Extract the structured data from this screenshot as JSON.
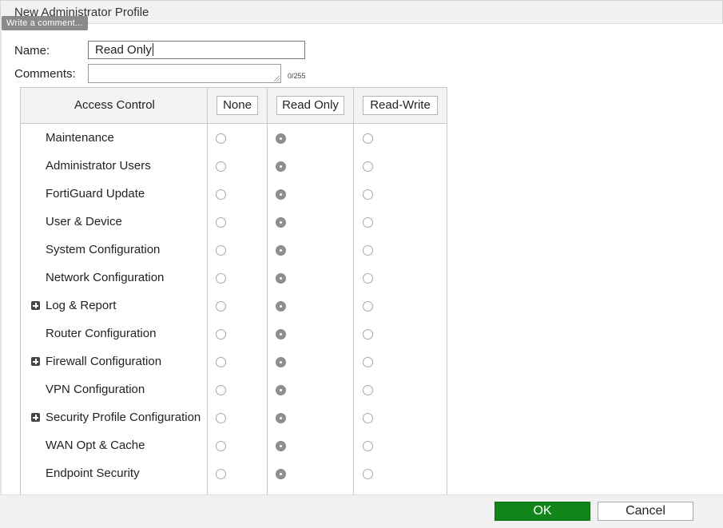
{
  "dialog": {
    "title": "New Administrator Profile",
    "tooltip": "Write a comment..."
  },
  "form": {
    "name_label": "Name:",
    "name_value": "Read Only",
    "comments_label": "Comments:",
    "comments_value": "",
    "comments_counter": "0/255"
  },
  "table": {
    "header": {
      "access_control": "Access Control",
      "none": "None",
      "read_only": "Read Only",
      "read_write": "Read-Write"
    },
    "rows": [
      {
        "label": "Maintenance",
        "expandable": false,
        "selected": "read_only"
      },
      {
        "label": "Administrator Users",
        "expandable": false,
        "selected": "read_only"
      },
      {
        "label": "FortiGuard Update",
        "expandable": false,
        "selected": "read_only"
      },
      {
        "label": "User & Device",
        "expandable": false,
        "selected": "read_only"
      },
      {
        "label": "System Configuration",
        "expandable": false,
        "selected": "read_only"
      },
      {
        "label": "Network Configuration",
        "expandable": false,
        "selected": "read_only"
      },
      {
        "label": "Log & Report",
        "expandable": true,
        "selected": "read_only"
      },
      {
        "label": "Router Configuration",
        "expandable": false,
        "selected": "read_only"
      },
      {
        "label": "Firewall Configuration",
        "expandable": true,
        "selected": "read_only"
      },
      {
        "label": "VPN Configuration",
        "expandable": false,
        "selected": "read_only"
      },
      {
        "label": "Security Profile Configuration",
        "expandable": true,
        "selected": "read_only"
      },
      {
        "label": "WAN Opt & Cache",
        "expandable": false,
        "selected": "read_only"
      },
      {
        "label": "Endpoint Security",
        "expandable": false,
        "selected": "read_only"
      }
    ]
  },
  "footer": {
    "ok_label": "OK",
    "cancel_label": "Cancel"
  },
  "colors": {
    "ok_button": "#11841a",
    "radio_checked": "#8f8f8f"
  },
  "icons": {
    "expander": "plus-square-icon"
  }
}
